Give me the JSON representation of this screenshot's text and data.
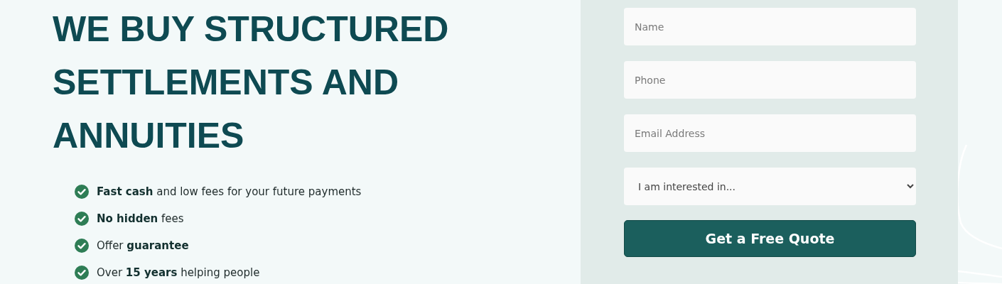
{
  "hero": {
    "heading": [
      "WE BUY STRUCTURED",
      "SETTLEMENTS AND",
      "ANNUITIES"
    ],
    "features": [
      "**Fast cash** and low fees for your future payments",
      "**No hidden** fees",
      "Offer **guarantee**",
      "Over **15 years** helping people"
    ]
  },
  "form": {
    "fields": [
      {
        "kind": "input",
        "placeholder": "Name"
      },
      {
        "kind": "input",
        "placeholder": "Phone"
      },
      {
        "kind": "input",
        "placeholder": "Email Address"
      },
      {
        "kind": "select",
        "value": "I am interested in..."
      }
    ],
    "submit": "Get a Free Quote"
  }
}
